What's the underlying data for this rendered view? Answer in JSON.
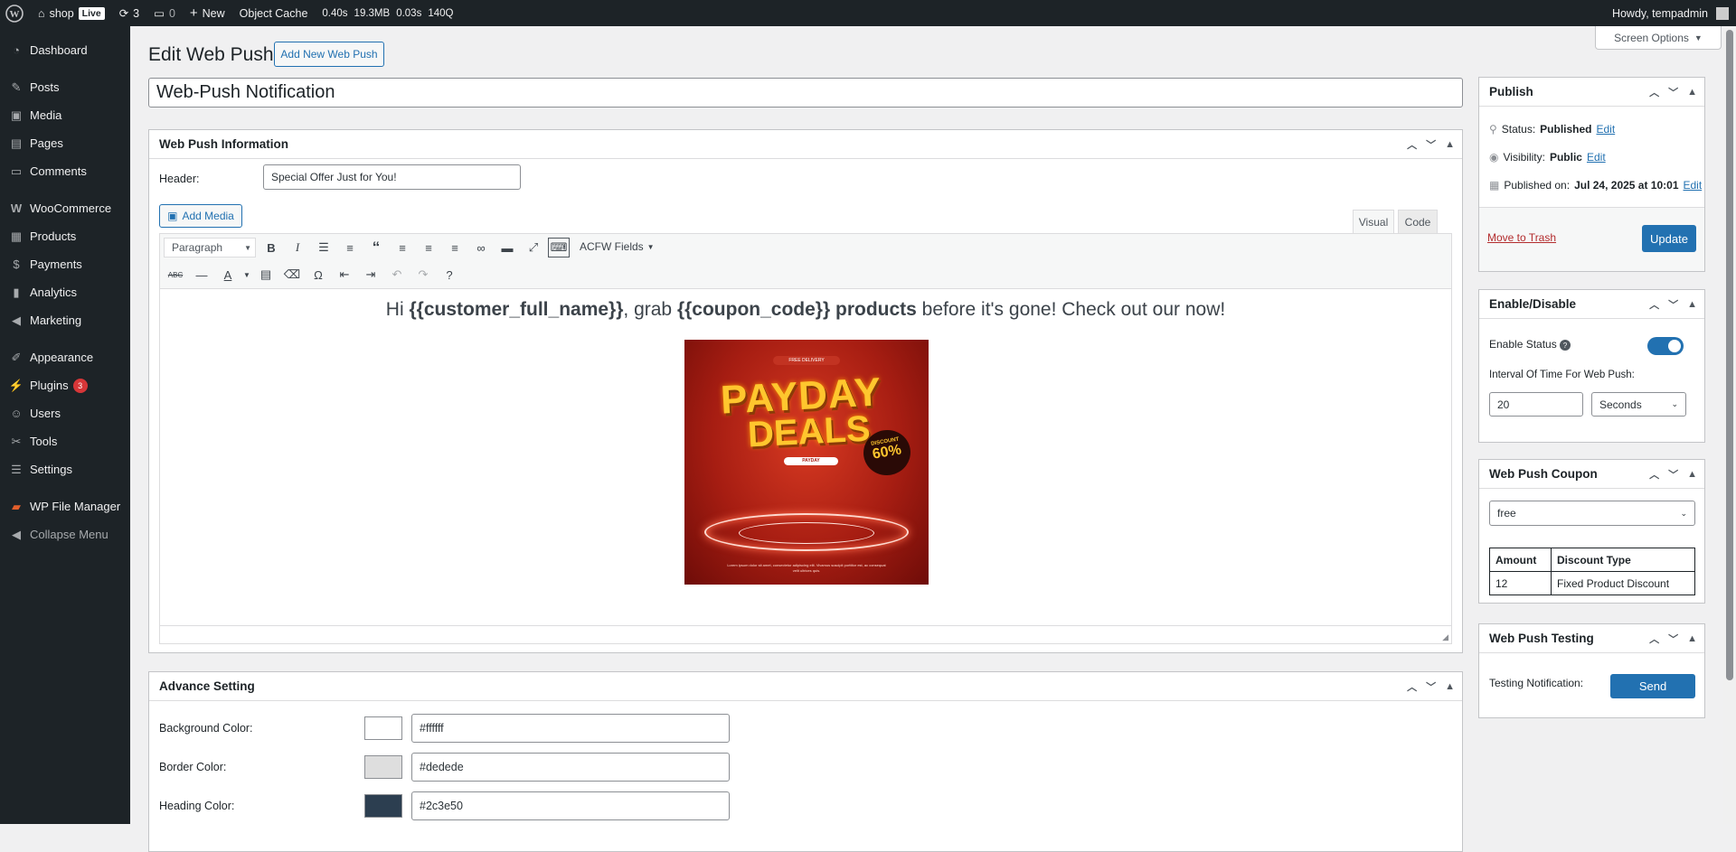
{
  "admin_bar": {
    "site": "shop",
    "live": "Live",
    "updates": "3",
    "comments": "0",
    "new": "New",
    "object_cache": "Object Cache",
    "qm_time": "0.40s",
    "qm_mem": "19.3MB",
    "qm_db": "0.03s",
    "qm_queries": "140Q",
    "howdy": "Howdy, tempadmin"
  },
  "sidebar": {
    "items": [
      {
        "label": "Dashboard",
        "icon": "dashboard-icon"
      },
      {
        "label": "Posts",
        "icon": "pin-icon"
      },
      {
        "label": "Media",
        "icon": "media-icon"
      },
      {
        "label": "Pages",
        "icon": "pages-icon"
      },
      {
        "label": "Comments",
        "icon": "comment-icon"
      },
      {
        "label": "WooCommerce",
        "icon": "woo-icon"
      },
      {
        "label": "Products",
        "icon": "archive-icon"
      },
      {
        "label": "Payments",
        "icon": "dollar-icon"
      },
      {
        "label": "Analytics",
        "icon": "bar-chart-icon"
      },
      {
        "label": "Marketing",
        "icon": "megaphone-icon"
      },
      {
        "label": "Appearance",
        "icon": "brush-icon"
      },
      {
        "label": "Plugins",
        "icon": "plug-icon",
        "count": "3"
      },
      {
        "label": "Users",
        "icon": "user-icon"
      },
      {
        "label": "Tools",
        "icon": "wrench-icon"
      },
      {
        "label": "Settings",
        "icon": "sliders-icon"
      },
      {
        "label": "WP File Manager",
        "icon": "folder-icon"
      },
      {
        "label": "Collapse Menu",
        "icon": "collapse-icon"
      }
    ]
  },
  "page": {
    "title": "Edit Web Push",
    "add_new": "Add New Web Push",
    "screen_options": "Screen Options",
    "post_title": "Web-Push Notification"
  },
  "info_box": {
    "title": "Web Push Information",
    "header_label": "Header:",
    "header_value": "Special Offer Just for You!",
    "add_media": "Add Media",
    "tab_visual": "Visual",
    "tab_code": "Code",
    "format": "Paragraph",
    "acfw_fields": "ACFW Fields",
    "content": {
      "p1": "Hi ",
      "b1": "{{customer_full_name}}",
      "p2": ", grab ",
      "b2": "{{coupon_code}} products",
      "p3": " before it's gone! Check out our  now!"
    },
    "promo": {
      "free_delivery": "FREE DELIVERY",
      "line1": "PAYDAY",
      "line2": "DEALS",
      "discount": "DISCOUNT",
      "pct": "60%",
      "pill": "PAYDAY",
      "footer": "Lorem ipsum dolor sit amet, consectetur adipiscing elit. Vivamus suscipit porttitor est, ac consequat velit ultrices quis."
    }
  },
  "advance": {
    "title": "Advance Setting",
    "rows": [
      {
        "label": "Background Color:",
        "value": "#ffffff",
        "color": "#ffffff"
      },
      {
        "label": "Border Color:",
        "value": "#dedede",
        "color": "#dedede"
      },
      {
        "label": "Heading Color:",
        "value": "#2c3e50",
        "color": "#2c3e50"
      }
    ]
  },
  "publish": {
    "title": "Publish",
    "status_label": "Status:",
    "status_value": "Published",
    "visibility_label": "Visibility:",
    "visibility_value": "Public",
    "published_label": "Published on:",
    "published_value": "Jul 24, 2025 at 10:01",
    "edit": "Edit",
    "trash": "Move to Trash",
    "update": "Update"
  },
  "enable": {
    "title": "Enable/Disable",
    "status_label": "Enable Status",
    "status_on": true,
    "interval_label": "Interval Of Time For Web Push:",
    "interval_value": "20",
    "unit": "Seconds"
  },
  "coupon": {
    "title": "Web Push Coupon",
    "selected": "free",
    "headers": [
      "Amount",
      "Discount Type"
    ],
    "row": [
      "12",
      "Fixed Product Discount"
    ]
  },
  "testing": {
    "title": "Web Push Testing",
    "label": "Testing Notification:",
    "send": "Send"
  },
  "colors": {
    "admin_dark": "#1d2327",
    "primary": "#2271b1",
    "danger": "#b32d2e"
  }
}
